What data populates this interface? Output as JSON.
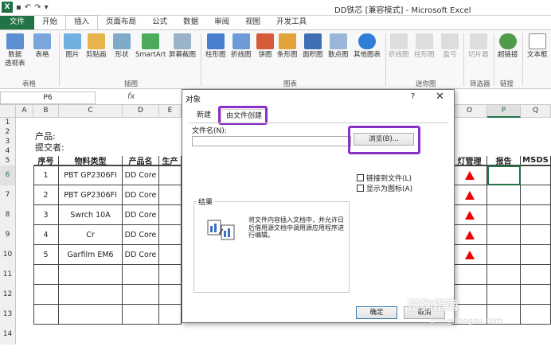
{
  "window": {
    "title": "DD铁芯 [兼容模式] - Microsoft Excel",
    "qat_icons": [
      "excel-icon",
      "save-icon",
      "undo-icon",
      "redo-icon",
      "customize-icon"
    ]
  },
  "ribbon": {
    "tabs": [
      "文件",
      "开始",
      "插入",
      "页面布局",
      "公式",
      "数据",
      "审阅",
      "视图",
      "开发工具"
    ],
    "active_tab": "插入",
    "buttons": {
      "pivot": "数据\n透视表",
      "table": "表格",
      "picture": "图片",
      "clipart": "剪贴画",
      "shapes": "形状",
      "smartart": "SmartArt",
      "screenshot": "屏幕截图",
      "column": "柱形图",
      "line": "折线图",
      "pie": "饼图",
      "bar": "条形图",
      "area": "面积图",
      "scatter": "散点图",
      "other": "其他图表",
      "spark_line": "折线图",
      "spark_column": "柱形图",
      "spark_winloss": "盈亏",
      "slicer": "切片器",
      "hyperlink": "超链接",
      "textbox": "文本框"
    },
    "groups": {
      "tables": "表格",
      "illustrations": "插图",
      "charts": "图表",
      "sparklines": "迷你图",
      "filter": "筛选器",
      "links": "链接"
    }
  },
  "formula_bar": {
    "name_box": "P6",
    "fx": "fx"
  },
  "sheet": {
    "columns": [
      "A",
      "B",
      "C",
      "D",
      "E",
      "O",
      "P",
      "Q"
    ],
    "rows": [
      "1",
      "2",
      "3",
      "4",
      "5",
      "6",
      "7",
      "8",
      "9",
      "10",
      "11",
      "12",
      "13",
      "14"
    ],
    "selected_column": "P",
    "selected_row": "6",
    "product_label": "产品:",
    "submitter_label": "提交者:",
    "table_headers": [
      "序号",
      "物料类型",
      "产品名",
      "生产",
      "灯管理",
      "报告",
      "MSDS"
    ],
    "table_rows": [
      [
        "1",
        "PBT GP2306FI",
        "DD Core"
      ],
      [
        "2",
        "PBT GP2306FI",
        "DD Core"
      ],
      [
        "3",
        "Swrch 10A",
        "DD Core"
      ],
      [
        "4",
        "Cr",
        "DD Core"
      ],
      [
        "5",
        "Garfilm EM6",
        "DD Core"
      ]
    ]
  },
  "dialog": {
    "title": "对象",
    "help": "?",
    "close": "✕",
    "tabs": [
      "新建",
      "由文件创建"
    ],
    "active_tab": "由文件创建",
    "filename_label": "文件名(N):",
    "filename_value": "",
    "browse_button": "浏览(B)...",
    "link_checkbox": "链接到文件(L)",
    "icon_checkbox": "显示为图标(A)",
    "result_title": "结果",
    "result_text": "将文件内容插入文档中，并允许日后借用源文档中调用源应用程序进行编辑。",
    "ok_button": "确定",
    "cancel_button": "取消"
  },
  "watermark": {
    "text1": "搜狗指南",
    "text2": "zhinan.sogou.com"
  },
  "colors": {
    "excel_green": "#217346",
    "highlight_purple": "#8b2fc9",
    "alert_red": "#ee0000"
  }
}
